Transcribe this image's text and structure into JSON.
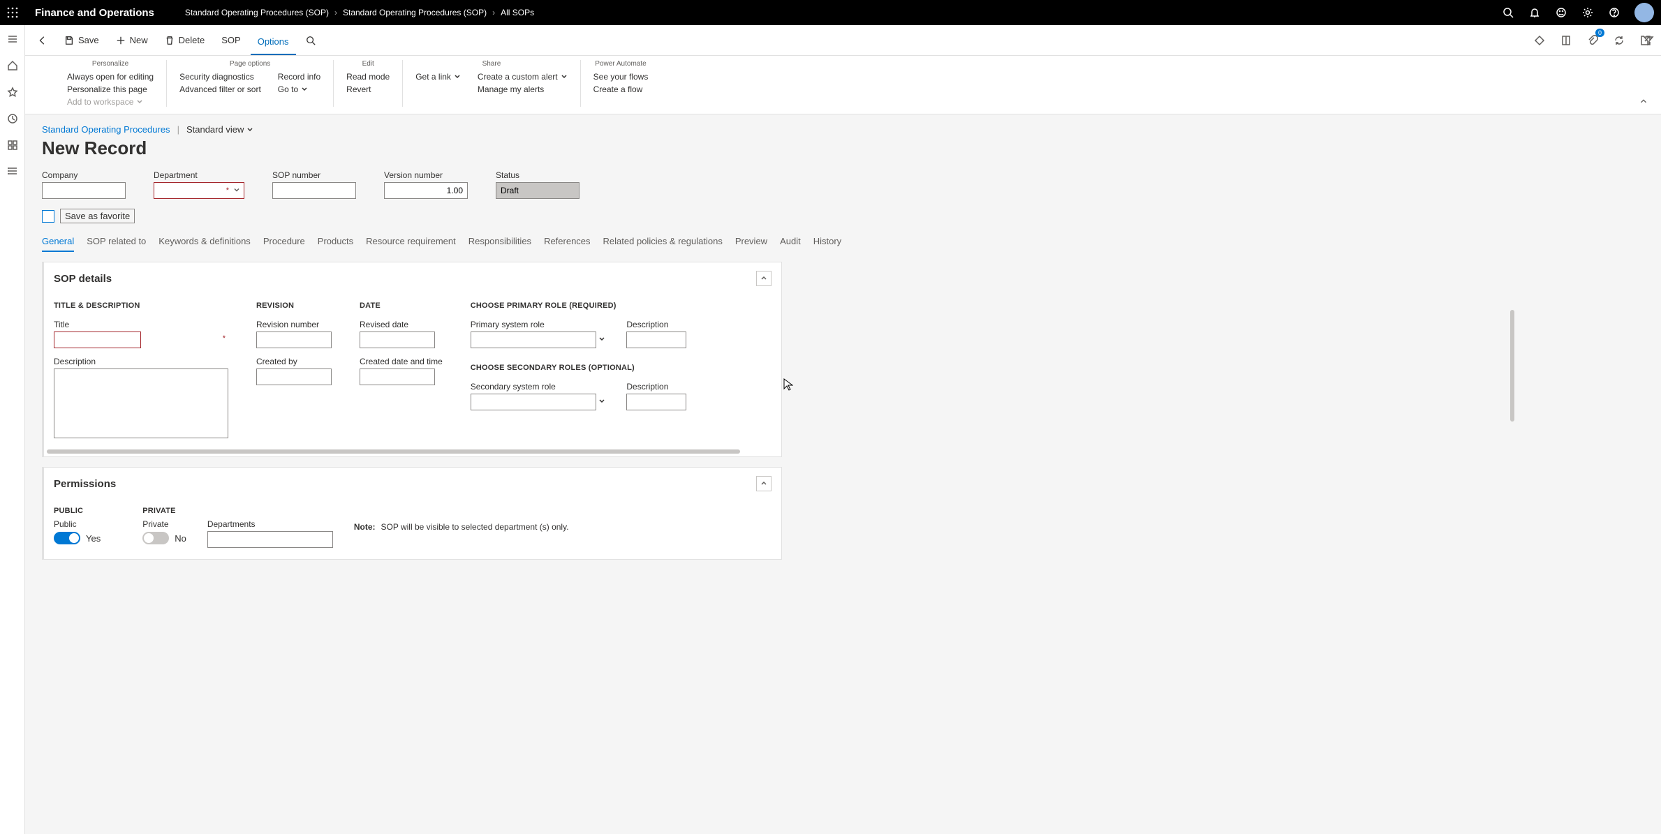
{
  "app": {
    "title": "Finance and Operations"
  },
  "breadcrumb": [
    "Standard Operating Procedures (SOP)",
    "Standard Operating Procedures (SOP)",
    "All SOPs"
  ],
  "actionbar": {
    "back": "Back",
    "save": "Save",
    "new": "New",
    "delete": "Delete",
    "sop": "SOP",
    "options": "Options",
    "attach_badge": "0"
  },
  "ribbon": {
    "groups": [
      {
        "title": "Personalize",
        "cols": [
          [
            "Always open for editing",
            "Personalize this page",
            "Add to workspace"
          ]
        ]
      },
      {
        "title": "Page options",
        "cols": [
          [
            "Security diagnostics",
            "Advanced filter or sort"
          ],
          [
            "Record info",
            "Go to"
          ]
        ]
      },
      {
        "title": "Edit",
        "cols": [
          [
            "Read mode",
            "Revert"
          ]
        ]
      },
      {
        "title": "Share",
        "cols": [
          [
            "Get a link"
          ],
          [
            "Create a custom alert",
            "Manage my alerts"
          ]
        ]
      },
      {
        "title": "Power Automate",
        "cols": [
          [
            "See your flows",
            "Create a flow"
          ]
        ]
      }
    ]
  },
  "page": {
    "entity_link": "Standard Operating Procedures",
    "view": "Standard view",
    "title": "New Record"
  },
  "header_fields": {
    "company": {
      "label": "Company",
      "value": ""
    },
    "department": {
      "label": "Department",
      "value": ""
    },
    "sop_number": {
      "label": "SOP number",
      "value": ""
    },
    "version": {
      "label": "Version number",
      "value": "1.00"
    },
    "status": {
      "label": "Status",
      "value": "Draft"
    },
    "save_favorite": "Save as favorite"
  },
  "tabs": [
    "General",
    "SOP related to",
    "Keywords & definitions",
    "Procedure",
    "Products",
    "Resource requirement",
    "Responsibilities",
    "References",
    "Related policies & regulations",
    "Preview",
    "Audit",
    "History"
  ],
  "sop_details": {
    "section_title": "SOP details",
    "title_desc_header": "TITLE & DESCRIPTION",
    "revision_header": "REVISION",
    "date_header": "DATE",
    "primary_role_header": "CHOOSE PRIMARY ROLE (REQUIRED)",
    "secondary_role_header": "CHOOSE SECONDARY ROLES (OPTIONAL)",
    "fields": {
      "title": "Title",
      "description": "Description",
      "revision_number": "Revision number",
      "created_by": "Created by",
      "revised_date": "Revised date",
      "created_datetime": "Created date and time",
      "primary_role": "Primary system role",
      "primary_desc": "Description",
      "secondary_role": "Secondary system role",
      "secondary_desc": "Description"
    }
  },
  "permissions": {
    "section_title": "Permissions",
    "public_header": "PUBLIC",
    "private_header": "PRIVATE",
    "public_label": "Public",
    "public_value": "Yes",
    "private_label": "Private",
    "private_value": "No",
    "departments_label": "Departments",
    "note_label": "Note:",
    "note_text": "SOP will be visible to selected department (s) only."
  }
}
